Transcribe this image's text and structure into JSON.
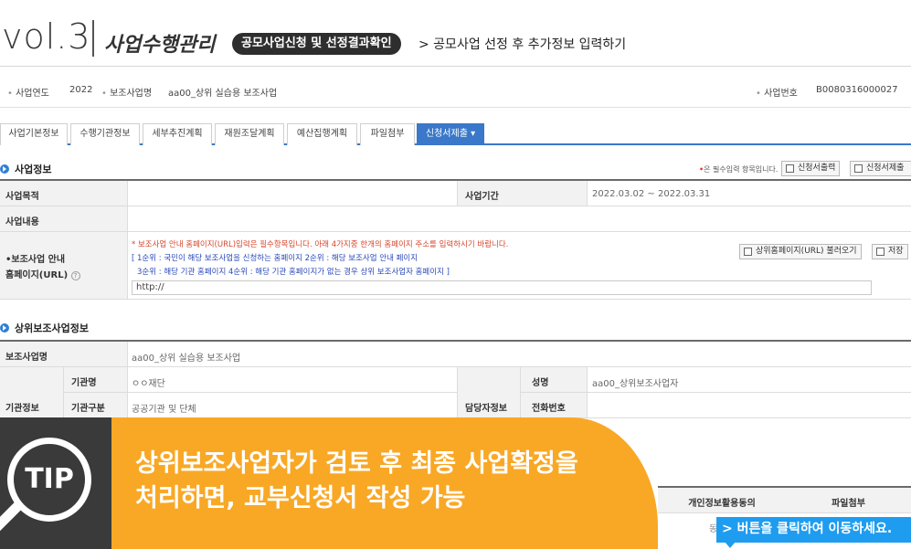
{
  "header": {
    "vol": "vol.3",
    "section_title": "사업수행관리",
    "pill": "공모사업신청 및 선정결과확인",
    "sub_path": "> 공모사업 선정 후 추가정보 입력하기"
  },
  "info": {
    "year_label": "사업연도",
    "year_value": "2022",
    "name_label": "보조사업명",
    "name_value": "aa00_상위 실습용 보조사업",
    "no_label": "사업번호",
    "no_value": "B0080316000027"
  },
  "tabs": [
    {
      "label": "사업기본정보"
    },
    {
      "label": "수행기관정보"
    },
    {
      "label": "세부추진계획"
    },
    {
      "label": "재원조달계획"
    },
    {
      "label": "예산집행계획"
    },
    {
      "label": "파일첨부"
    },
    {
      "label": "신청서제출 ▾"
    }
  ],
  "business": {
    "heading": "사업정보",
    "required_note_mark": "•",
    "required_note": "은 필수입력 항목입니다.",
    "print_button": "신청서출력",
    "submit_button": "신청서제출",
    "purpose_label": "사업목적",
    "period_label": "사업기간",
    "period_value": "2022.03.02 ~ 2022.03.31",
    "content_label": "사업내용",
    "homepage_label_1": "•보조사업 안내",
    "homepage_label_2": "홈페이지(URL)",
    "homepage_help": "?",
    "notice_red": "* 보조사업 안내 홈페이지(URL)입력은 필수항목입니다.    아래 4가지중 한개의 홈페이지 주소를 입력하시기 바랍니다.",
    "notice_blue_1": "[ 1순위 : 국민이 해당 보조사업을 신청하는 홈페이지    2순위 : 해당 보조사업 안내 페이지",
    "notice_blue_2": "3순위 : 해당 기관 홈페이지              4순위 : 해당 기관 홈페이지가 없는 경우 상위 보조사업자 홈페이지  ]",
    "load_button": "상위홈페이지(URL) 불러오기",
    "save_button": "저장",
    "url_value": "http://"
  },
  "upper": {
    "heading": "상위보조사업정보",
    "name_label": "보조사업명",
    "name_value": "aa00_상위 실습용 보조사업",
    "org_info_label": "기관정보",
    "org_name_label": "기관명",
    "org_name_value": "ㅇㅇ재단",
    "org_type_label": "기관구분",
    "org_type_value": "공공기관 및 단체",
    "manager_label": "담당자정보",
    "person_label": "성명",
    "person_value": "aa00_상위보조사업자",
    "phone_label": "전화번호"
  },
  "bottom_table": {
    "col1": "개인정보활용동의",
    "col2": "파일첨부",
    "cell_partial": "동"
  },
  "tip": {
    "badge": "TIP",
    "line1": "상위보조사업자가 검토 후 최종 사업확정을",
    "line2": "처리하면, 교부신청서 작성 가능"
  },
  "cta": "> 버튼을 클릭하여 이동하세요."
}
